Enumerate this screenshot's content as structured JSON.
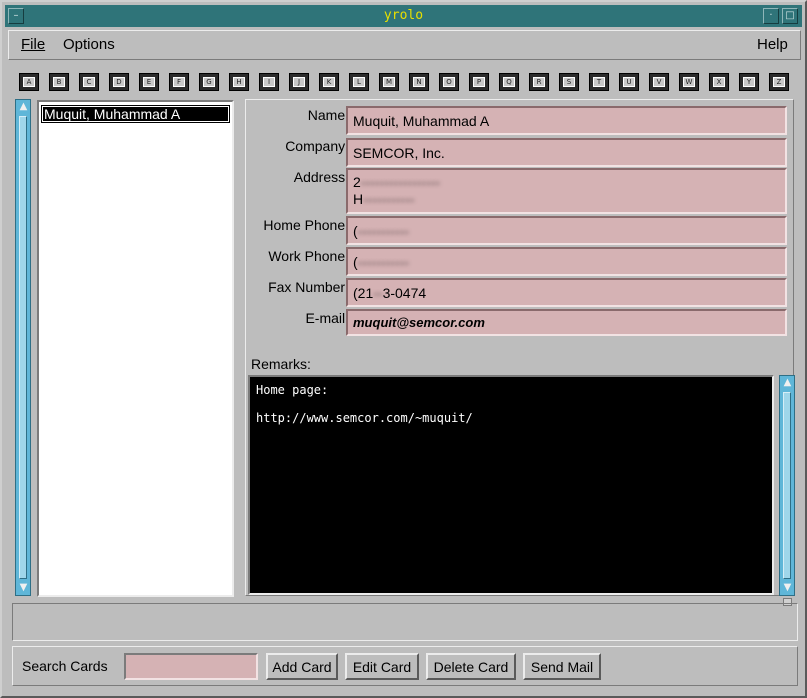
{
  "window": {
    "title": "yrolo",
    "controls": {
      "menu_icon": "window-menu-icon",
      "minimize_icon": "minimize-icon",
      "maximize_icon": "maximize-icon"
    }
  },
  "menubar": {
    "file": "File",
    "options": "Options",
    "help": "Help"
  },
  "alpha_tabs": [
    "A",
    "B",
    "C",
    "D",
    "E",
    "F",
    "G",
    "H",
    "I",
    "J",
    "K",
    "L",
    "M",
    "N",
    "O",
    "P",
    "Q",
    "R",
    "S",
    "T",
    "U",
    "V",
    "W",
    "X",
    "Y",
    "Z"
  ],
  "card_list": {
    "selected": "Muquit, Muhammad A"
  },
  "card": {
    "name_label": "Name:",
    "name": "Muquit, Muhammad A",
    "company_label": "Company:",
    "company": "SEMCOR, Inc.",
    "address_label": "Address:",
    "address_line1_visible": "2",
    "address_line2_visible": "H",
    "home_phone_label": "Home Phone:",
    "home_phone_visible": "(",
    "work_phone_label": "Work Phone:",
    "work_phone_visible": "(",
    "fax_label": "Fax Number:",
    "fax": "(21",
    "fax_tail": "3-0474",
    "email_label": "E-mail:",
    "email": "muquit@semcor.com",
    "remarks_label": "Remarks:",
    "remarks_lines": [
      "Home page:",
      "http://www.semcor.com/~muquit/"
    ]
  },
  "bottom": {
    "search_label": "Search Cards",
    "search_value": "",
    "add_card": "Add Card",
    "edit_card": "Edit Card",
    "delete_card": "Delete Card",
    "send_mail": "Send Mail"
  },
  "colors": {
    "titlebar": "#2f7479",
    "title_text": "#e8e000",
    "field_bg": "#d5b2b4",
    "scrollbar": "#5fb6d8",
    "panel": "#bdbdbd"
  }
}
